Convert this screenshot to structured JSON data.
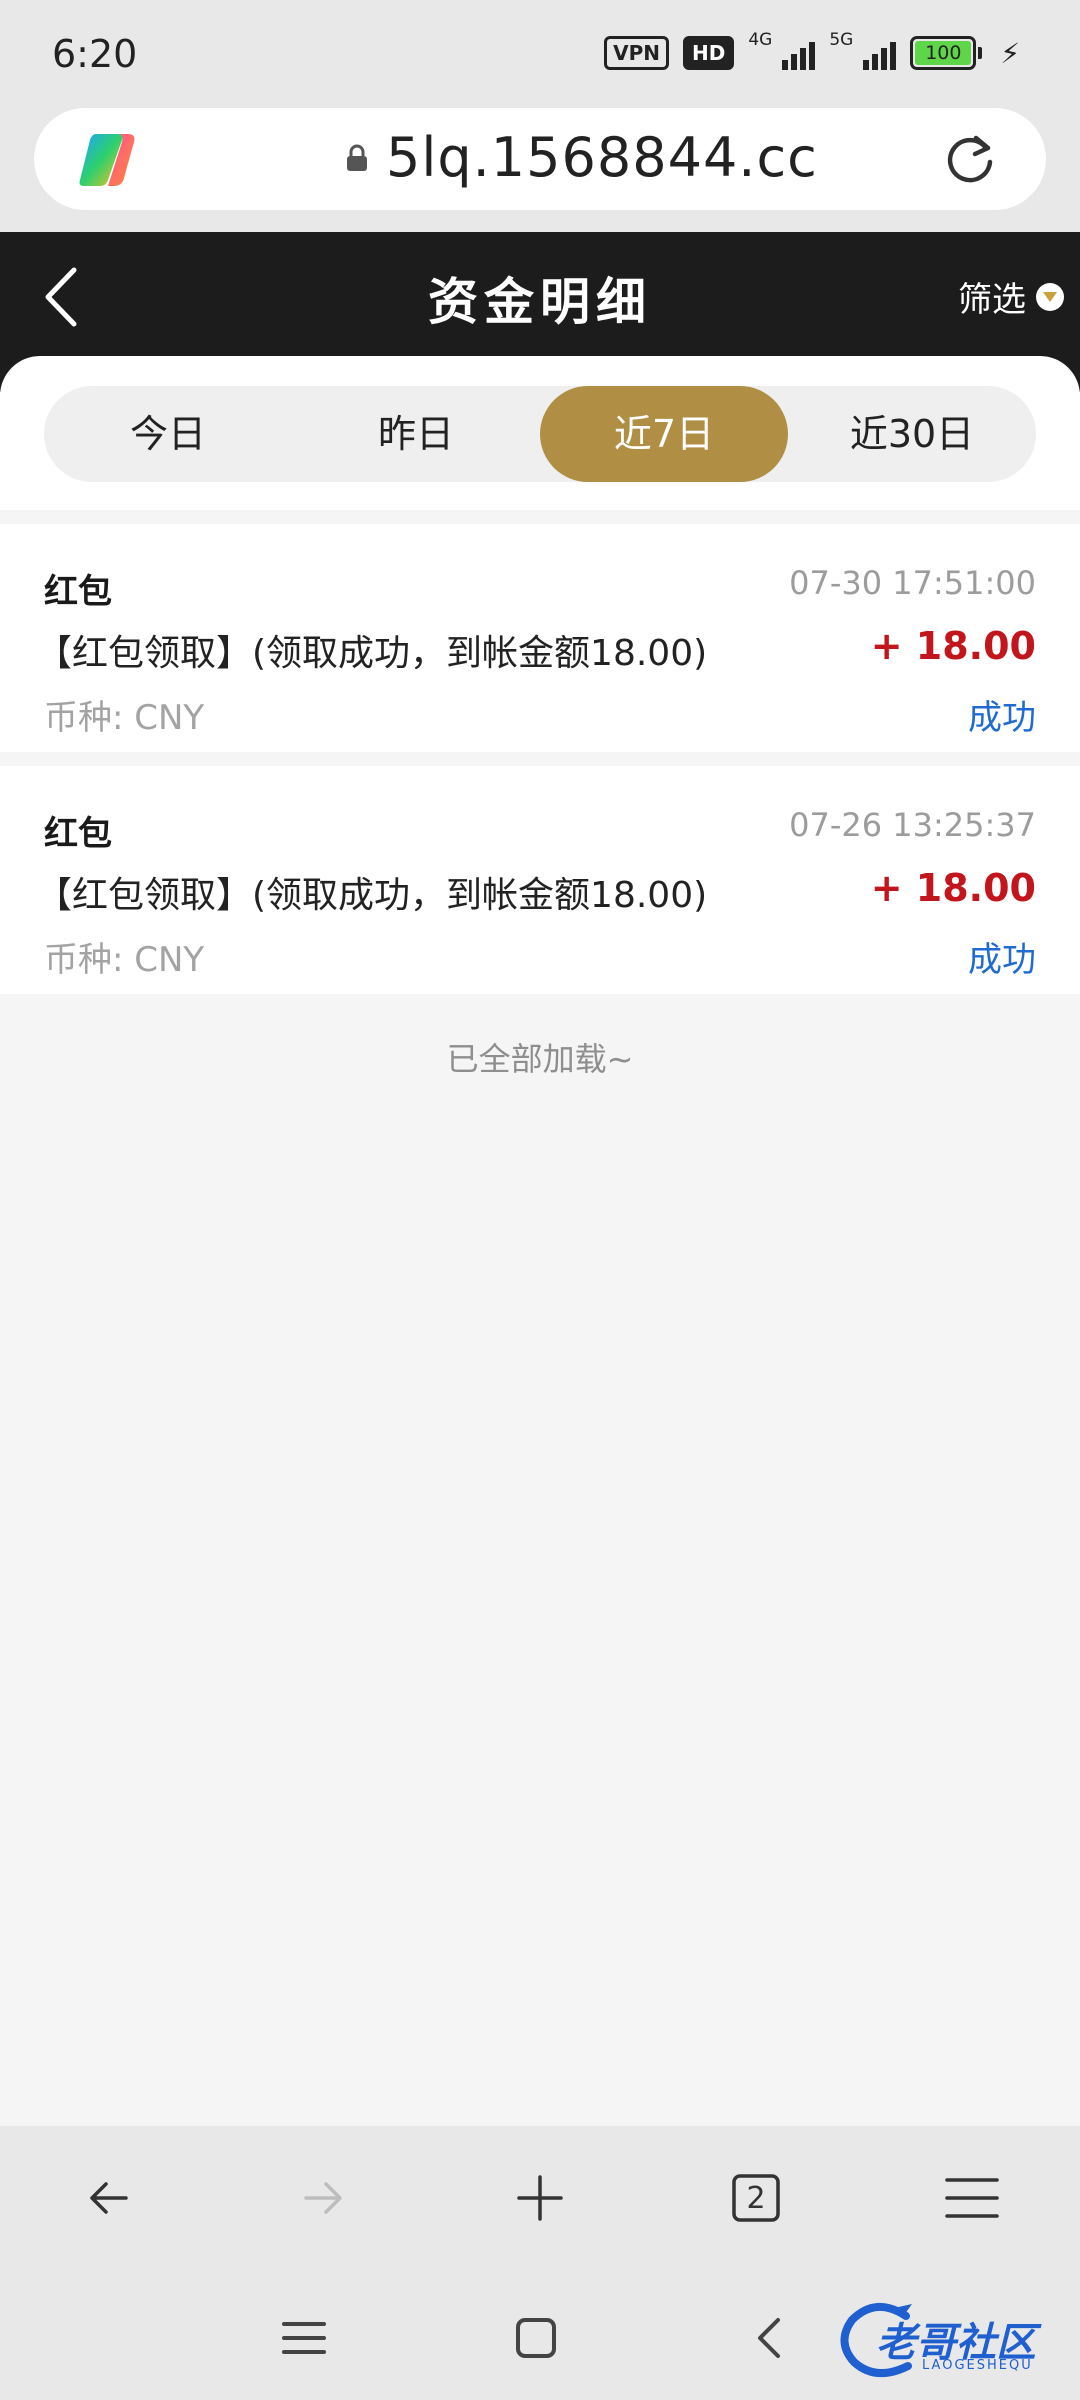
{
  "status_bar": {
    "time": "6:20",
    "vpn": "VPN",
    "hd": "HD",
    "net1": "4G",
    "net2": "5G",
    "battery": "100",
    "icons": [
      "vpn-icon",
      "hd-icon",
      "signal-4g-icon",
      "signal-5g-icon",
      "battery-icon",
      "charging-icon"
    ]
  },
  "browser": {
    "url": "5lq.1568844.cc",
    "icons": [
      "copilot-icon",
      "lock-icon",
      "reload-icon"
    ]
  },
  "header": {
    "title": "资金明细",
    "filter_label": "筛选",
    "icons": [
      "back-arrow-icon",
      "filter-dropdown-icon"
    ]
  },
  "tabs": [
    {
      "label": "今日",
      "active": false
    },
    {
      "label": "昨日",
      "active": false
    },
    {
      "label": "近7日",
      "active": true
    },
    {
      "label": "近30日",
      "active": false
    }
  ],
  "records": [
    {
      "type": "红包",
      "time": "07-30 17:51:00",
      "description": "【红包领取】(领取成功，到帐金额18.00)",
      "amount": "+ 18.00",
      "currency": "币种: CNY",
      "status": "成功"
    },
    {
      "type": "红包",
      "time": "07-26 13:25:37",
      "description": "【红包领取】(领取成功，到帐金额18.00)",
      "amount": "+ 18.00",
      "currency": "币种: CNY",
      "status": "成功"
    }
  ],
  "list_end_text": "已全部加载~",
  "toolbar": {
    "tab_count": "2",
    "icons": [
      "back-icon",
      "forward-icon",
      "new-tab-icon",
      "tabs-icon",
      "menu-icon"
    ]
  },
  "system_nav": {
    "icons": [
      "recent-apps-icon",
      "home-icon",
      "back-nav-icon"
    ]
  },
  "watermark": {
    "text": "老哥社区",
    "sub": "LAOGESHEQU"
  },
  "colors": {
    "header_bg": "#1c1c1c",
    "tab_active": "#b08f45",
    "amount": "#c3161c",
    "status": "#1f6bd0"
  }
}
